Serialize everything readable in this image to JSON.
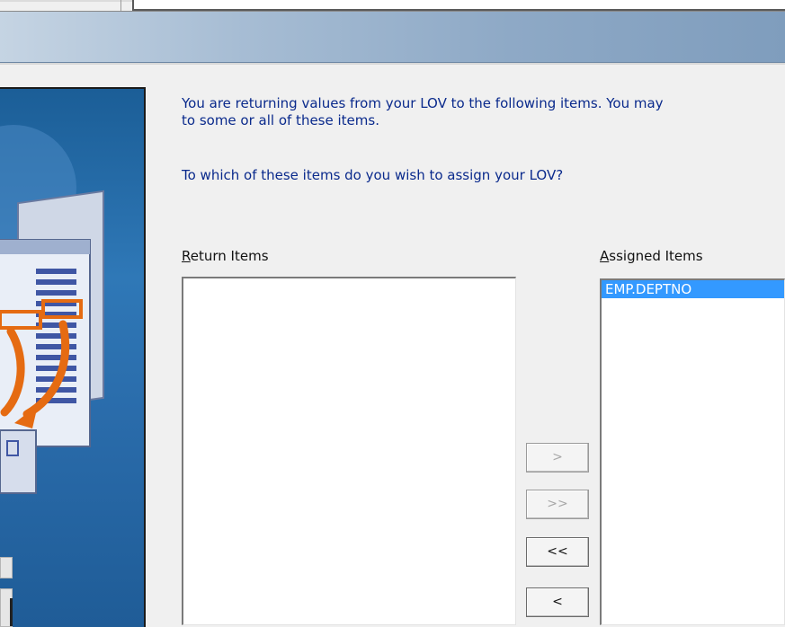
{
  "wizard": {
    "instruction_line1": "You are returning values from your LOV to the following items. You may",
    "instruction_line2": "to some or all of these items.",
    "question": "To which of these items do you wish to assign your LOV?"
  },
  "return_items": {
    "label_mnemonic": "R",
    "label_rest": "eturn Items",
    "items": []
  },
  "assigned_items": {
    "label_mnemonic": "A",
    "label_rest": "ssigned Items",
    "items": [
      {
        "label": "EMP.DEPTNO",
        "selected": true
      }
    ]
  },
  "move_buttons": {
    "add_one": "&gt;",
    "add_all": "&gt;&gt;",
    "remove_all": "&lt;&lt;",
    "remove_one": "&lt;"
  },
  "colors": {
    "instruction_text": "#0a2a8c",
    "selection": "#3399ff"
  }
}
